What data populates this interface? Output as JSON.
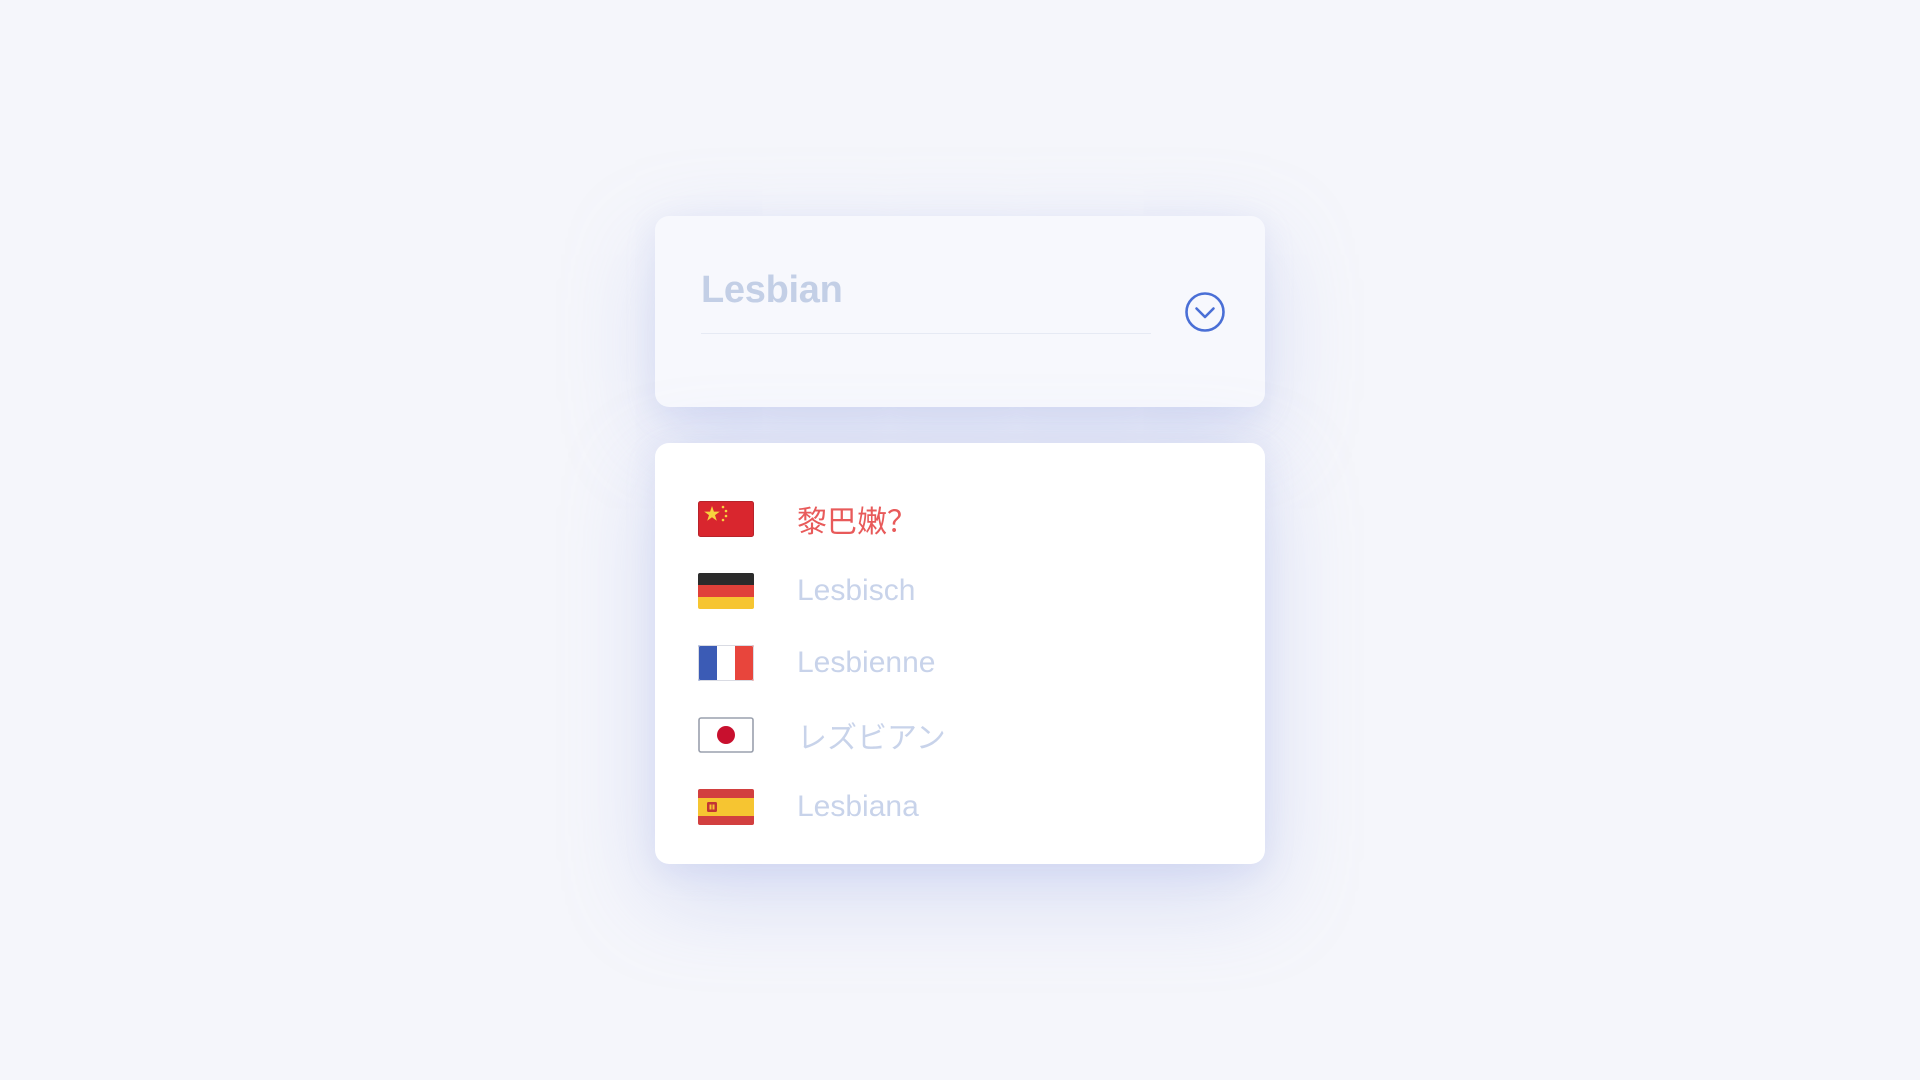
{
  "select": {
    "placeholder": "Lesbian",
    "value": "",
    "toggle_icon": "chevron-down-circle-icon",
    "accent_color": "#4a6fd6"
  },
  "options": [
    {
      "flag": "china-flag-icon",
      "label": "黎巴嫩？",
      "selected": true
    },
    {
      "flag": "germany-flag-icon",
      "label": "Lesbisch",
      "selected": false
    },
    {
      "flag": "france-flag-icon",
      "label": "Lesbienne",
      "selected": false
    },
    {
      "flag": "japan-flag-icon",
      "label": "レズビアン",
      "selected": false
    },
    {
      "flag": "spain-flag-icon",
      "label": "Lesbiana",
      "selected": false
    }
  ],
  "colors": {
    "background": "#f5f6fb",
    "highlight_text": "#e85a5a",
    "muted_text": "#c8d3ea"
  }
}
